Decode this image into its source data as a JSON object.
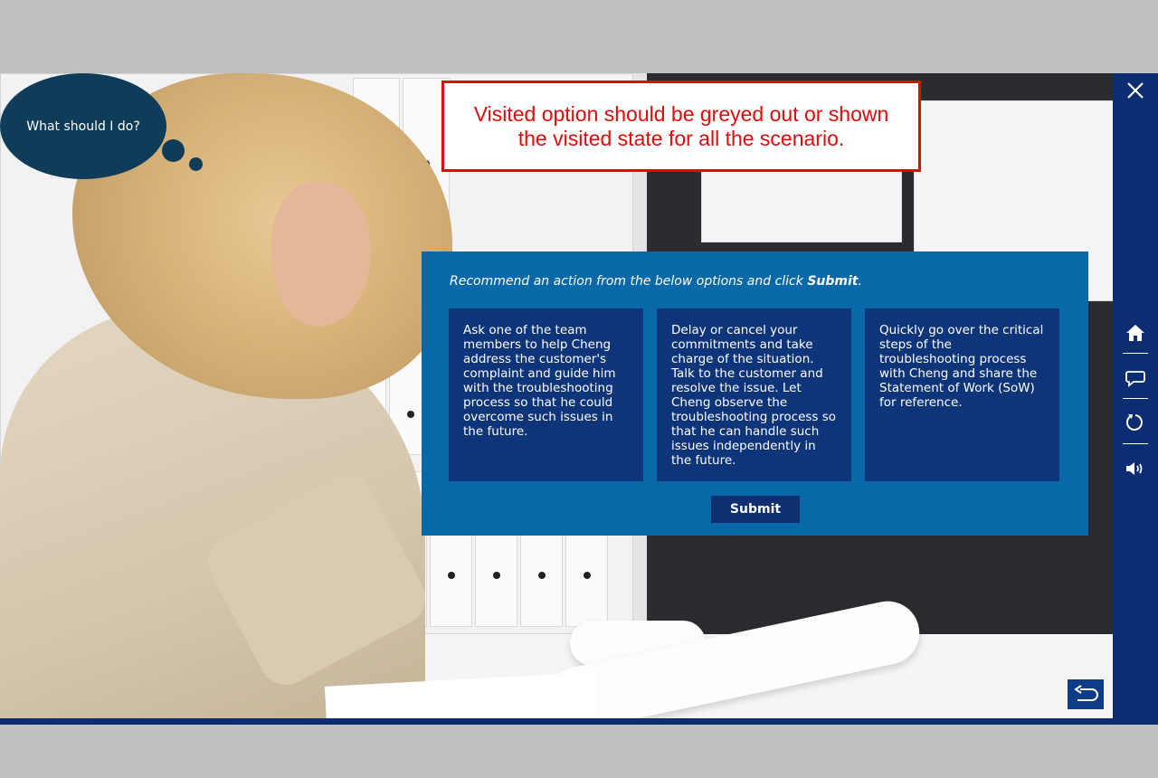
{
  "bubble": {
    "text": "What should I do?"
  },
  "annotation": {
    "text": "Visited option should be greyed out or shown the visited state for all the scenario."
  },
  "panel": {
    "instruction_prefix": "Recommend an action from the below options and click ",
    "instruction_bold": "Submit",
    "instruction_suffix": ".",
    "options": [
      {
        "text": "Ask one of the team members to help Cheng address the customer's complaint and guide him with the troubleshooting process so that he could overcome such issues in the future."
      },
      {
        "text": "Delay or cancel your commitments and take charge of the situation. Talk to the customer and resolve the issue. Let Cheng observe the troubleshooting process so that he can handle such issues independently in the future."
      },
      {
        "text": "Quickly go over the critical steps of the troubleshooting process with Cheng and share the Statement of Work (SoW) for reference."
      }
    ],
    "submit_label": "Submit"
  },
  "sidebar": {
    "buttons": [
      "close-icon",
      "home-icon",
      "chat-icon",
      "replay-icon",
      "volume-icon"
    ]
  },
  "footer": {
    "back_button": "back-arrow-icon"
  },
  "colors": {
    "panel": "#0868a8",
    "option": "#0e347a",
    "sidebar": "#0d2d72",
    "bubble": "#0e3c59",
    "annotation": "#e10a0a"
  }
}
